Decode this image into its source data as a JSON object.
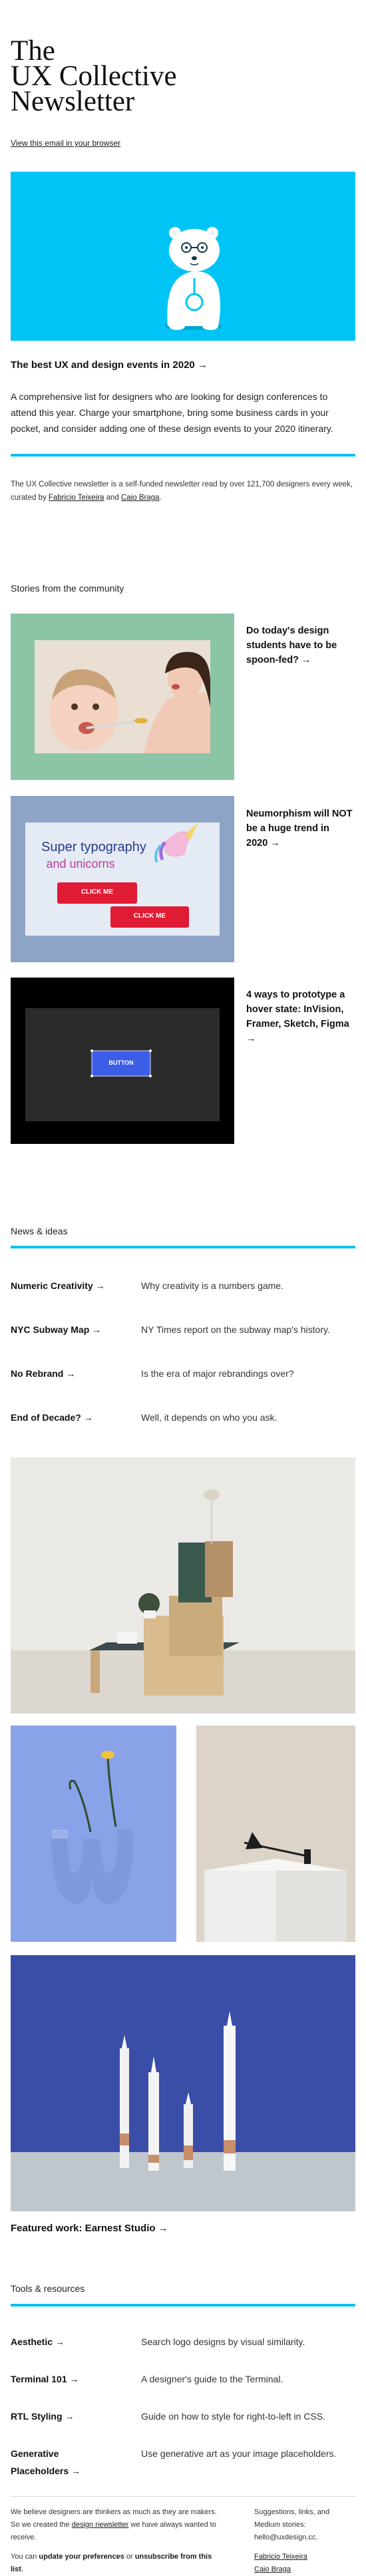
{
  "masthead": {
    "line1": "The",
    "line2": "UX Collective",
    "line3": "Newsletter",
    "browser_link": "View this email in your browser"
  },
  "hero": {
    "title": "The best UX and design events in 2020 →",
    "text": "A comprehensive list for designers who are looking for design conferences to attend this year. Charge your smartphone, bring some business cards in your pocket, and consider adding one of these design events to your 2020 itinerary.",
    "illustration_icon": "polar-bear-icon",
    "background_color": "#00c4f5"
  },
  "intro": {
    "text_before": "The UX Collective newsletter is a self-funded newsletter read by over 121,700 designers every week, curated by ",
    "curator1": "Fabricio Teixeira",
    "text_and": " and ",
    "curator2": "Caio Braga",
    "text_end": "."
  },
  "community": {
    "heading": "Stories from the community",
    "stories": [
      {
        "title": "Do today's design students have to be spoon-fed? →"
      },
      {
        "title": "Neumorphism will NOT be a huge trend in 2020 →"
      },
      {
        "title": "4 ways to prototype a hover state: InVision, Framer, Sketch, Figma →"
      }
    ],
    "neumorphism_art": {
      "headline1": "Super typography",
      "headline2": "and unicorns",
      "button1": "CLICK ME",
      "button2": "CLICK ME"
    },
    "hover_art": {
      "button": "BUTTON"
    }
  },
  "news": {
    "heading": "News & ideas",
    "items": [
      {
        "title": "Numeric Creativity →",
        "desc": "Why creativity is a numbers game."
      },
      {
        "title": "NYC Subway Map →",
        "desc": "NY Times report on the subway map's history."
      },
      {
        "title": "No Rebrand →",
        "desc": "Is the era of major rebrandings over?"
      },
      {
        "title": "End of Decade? →",
        "desc": "Well, it depends on who you ask."
      }
    ]
  },
  "featured": {
    "caption": "Featured work: Earnest Studio →"
  },
  "tools": {
    "heading": "Tools & resources",
    "items": [
      {
        "title": "Aesthetic →",
        "desc": "Search logo designs by visual similarity."
      },
      {
        "title": "Terminal 101 →",
        "desc": "A designer's guide to the Terminal."
      },
      {
        "title": "RTL Styling →",
        "desc": "Guide on how to style for right-to-left in CSS."
      },
      {
        "title": "Generative Placeholders →",
        "desc": "Use generative art as your image placeholders."
      }
    ]
  },
  "footer": {
    "line1_before": "We believe designers are thinkers as much as they are makers. So we created the ",
    "line1_link": "design newsletter",
    "line1_after": " we have always wanted to receive.",
    "line2_before": "You can ",
    "line2_link1": "update your preferences",
    "line2_or": " or ",
    "line2_link2": "unsubscribe from this list",
    "line2_end": ".",
    "right_text": "Suggestions, links, and Medium stories: hello@uxdesign.cc.",
    "right_link1": "Fabricio Teixeira",
    "right_link2": "Caio Braga"
  },
  "colors": {
    "accent": "#00c2ef",
    "text": "#1a1a1a"
  }
}
